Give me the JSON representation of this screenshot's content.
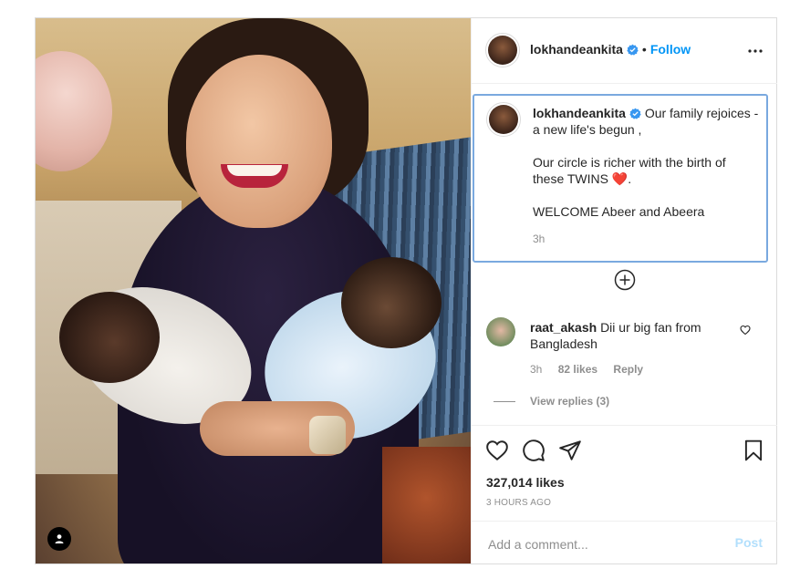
{
  "header": {
    "username": "lokhandeankita",
    "dot": "•",
    "follow_label": "Follow",
    "more_icon": "more-horizontal-icon"
  },
  "caption": {
    "username": "lokhandeankita",
    "text": "Our family rejoices - a new life's begun ,\n\nOur circle is richer with the birth of these TWINS ❤️.\n\nWELCOME Abeer and Abeera",
    "time": "3h"
  },
  "load_more_icon": "plus-circle-icon",
  "comment": {
    "username": "raat_akash",
    "text": "Dii ur big fan from Bangladesh",
    "time": "3h",
    "likes": "82 likes",
    "reply_label": "Reply",
    "view_replies": "View replies (3)"
  },
  "actions": {
    "like_icon": "heart-icon",
    "comment_icon": "comment-icon",
    "share_icon": "send-icon",
    "save_icon": "bookmark-icon",
    "likes": "327,014 likes",
    "time_ago": "3 HOURS AGO"
  },
  "add_comment": {
    "placeholder": "Add a comment...",
    "post_label": "Post"
  },
  "colors": {
    "link_blue": "#0095f6",
    "post_disabled": "#b2dffc",
    "caption_focus_border": "#7aa9df",
    "muted_text": "#8e8e8e"
  }
}
